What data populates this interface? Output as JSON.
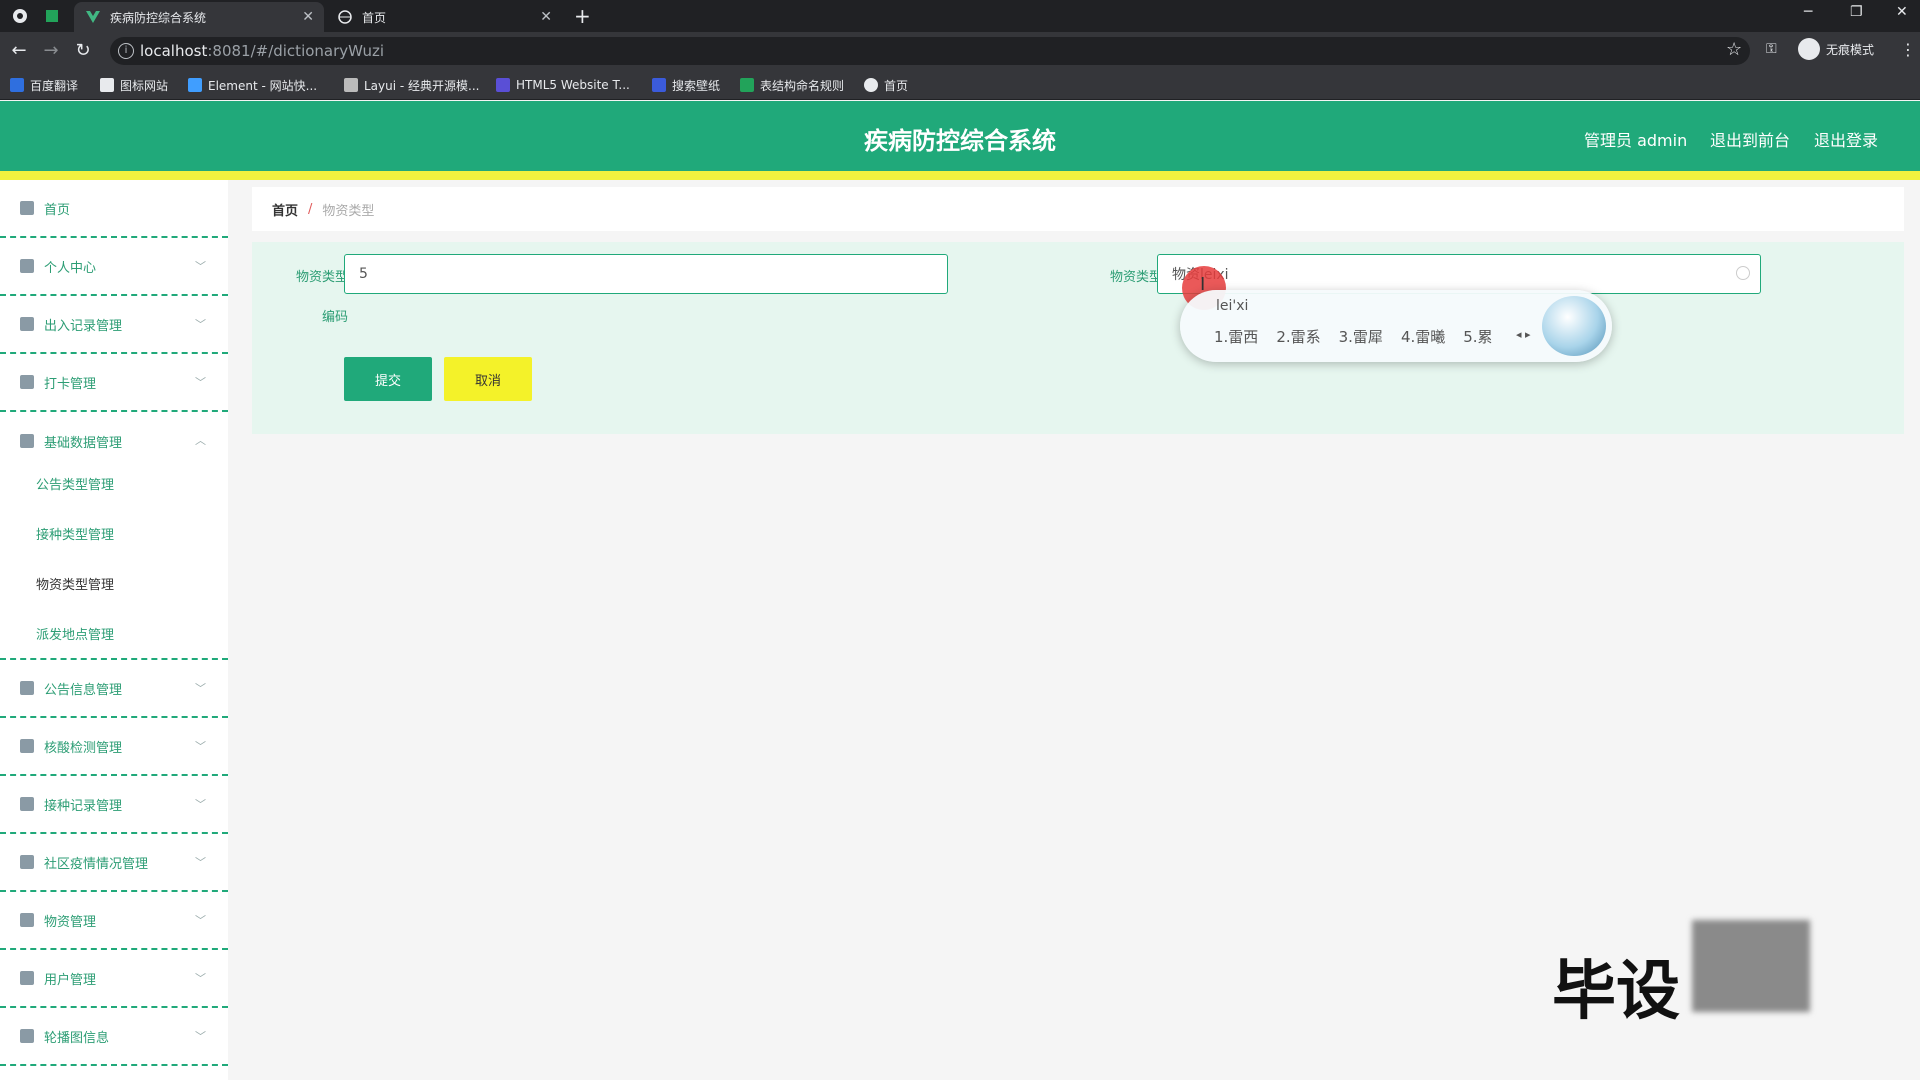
{
  "browser": {
    "tabs": [
      {
        "title": "疾病防控综合系统",
        "active": true
      },
      {
        "title": "首页",
        "active": false
      }
    ],
    "url_host": "localhost",
    "url_path": ":8081/#/dictionaryWuzi",
    "incognito_label": "无痕模式",
    "bookmarks": [
      "百度翻译",
      "图标网站",
      "Element - 网站快...",
      "Layui - 经典开源模...",
      "HTML5 Website T...",
      "搜索壁纸",
      "表结构命名规则",
      "首页"
    ]
  },
  "header": {
    "title": "疾病防控综合系统",
    "admin_label": "管理员 admin",
    "front_link": "退出到前台",
    "logout_link": "退出登录"
  },
  "sidebar": {
    "items": [
      {
        "label": "首页",
        "icon": "home-icon"
      },
      {
        "label": "个人中心",
        "icon": "user-icon"
      },
      {
        "label": "出入记录管理",
        "icon": "send-icon"
      },
      {
        "label": "打卡管理",
        "icon": "briefcase-icon"
      },
      {
        "label": "基础数据管理",
        "icon": "clipboard-icon"
      },
      {
        "label": "公告信息管理",
        "icon": "copy-icon"
      },
      {
        "label": "核酸检测管理",
        "icon": "bar-chart-icon"
      },
      {
        "label": "接种记录管理",
        "icon": "crop-icon"
      },
      {
        "label": "社区疫情情况管理",
        "icon": "forbidden-icon"
      },
      {
        "label": "物资管理",
        "icon": "box-icon"
      },
      {
        "label": "用户管理",
        "icon": "user-box-icon"
      },
      {
        "label": "轮播图信息",
        "icon": "sliders-icon"
      }
    ],
    "subitems": [
      "公告类型管理",
      "接种类型管理",
      "物资类型管理",
      "派发地点管理"
    ]
  },
  "breadcrumb": {
    "home": "首页",
    "sep": "/",
    "current": "物资类型"
  },
  "form": {
    "code_label_line1": "物资类型",
    "code_label_line2": "编码",
    "code_value": "5",
    "type_label": "物资类型",
    "type_value": "物资leixi",
    "submit_label": "提交",
    "cancel_label": "取消"
  },
  "ime": {
    "pinyin": "lei'xi",
    "candidates": [
      "1.雷西",
      "2.雷系",
      "3.雷犀",
      "4.雷曦",
      "5.累"
    ]
  },
  "watermark": "毕设",
  "colors": {
    "primary": "#20a97a",
    "yellow": "#f0f23f",
    "panel": "#e6f6ef"
  }
}
